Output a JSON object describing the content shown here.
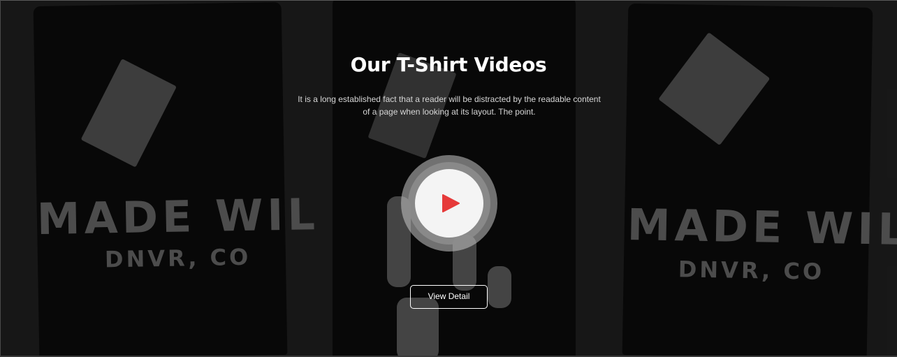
{
  "section": {
    "title": "Our T-Shirt Videos",
    "description": "It is a long established fact that a reader will be distracted by the readable content of a page when looking at its layout. The point.",
    "button_label": "View Detail"
  },
  "background": {
    "shirt_left_line1": "MADE WIL",
    "shirt_left_line2": "DNVR, CO",
    "shirt_right_line1": "MADE WIL",
    "shirt_right_line2": "DNVR, CO"
  },
  "icons": {
    "play": "play-icon"
  },
  "colors": {
    "play_triangle": "#e63a3a",
    "button_border": "#ffffff",
    "title_text": "#ffffff"
  }
}
